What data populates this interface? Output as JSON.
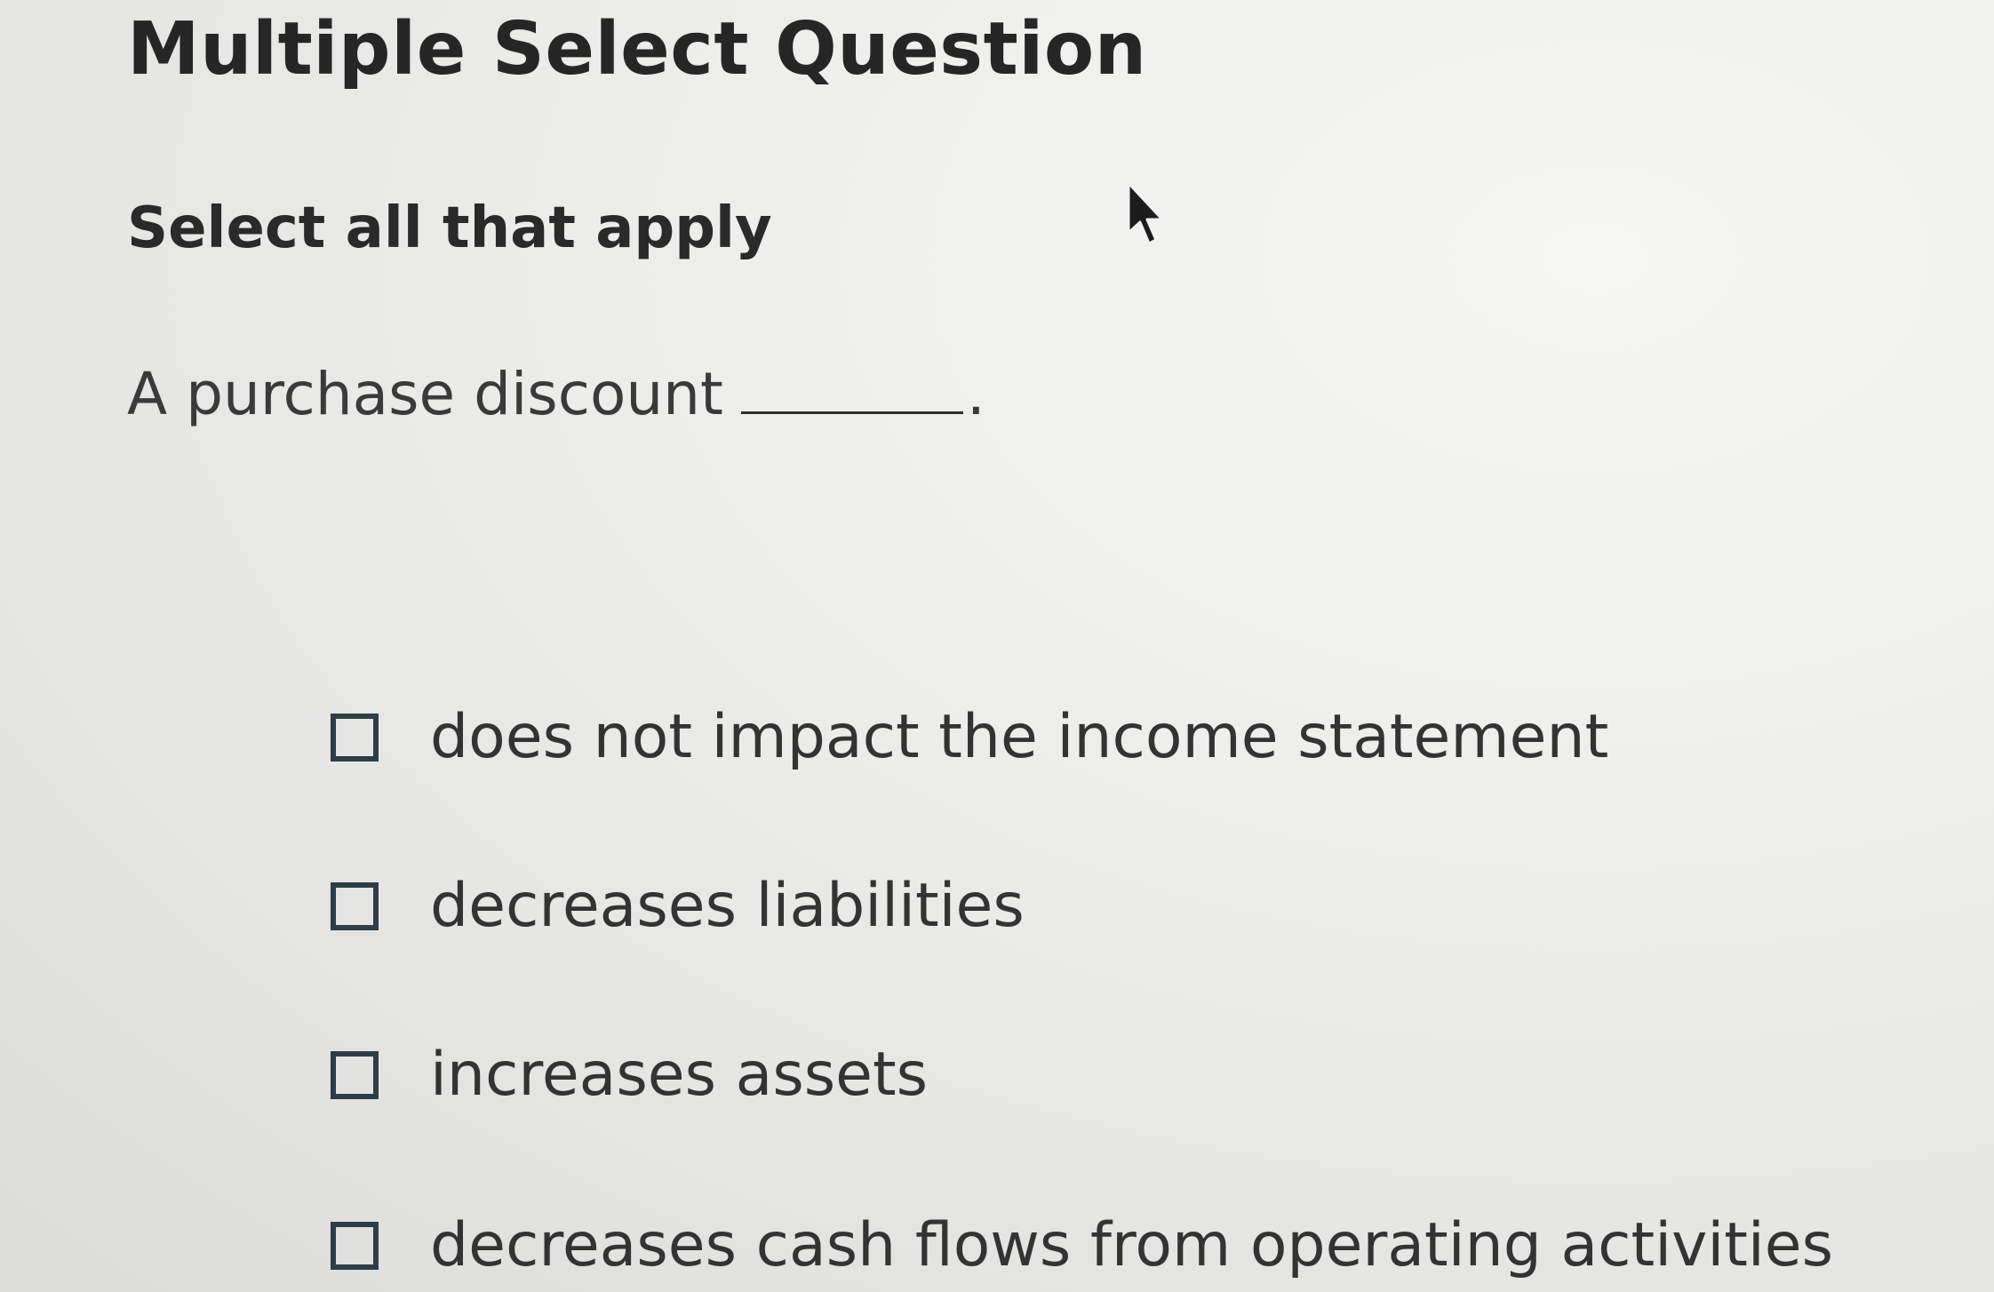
{
  "header": {
    "title": "Multiple Select Question"
  },
  "instruction": "Select all that apply",
  "question": {
    "text": "A purchase discount",
    "suffix": "."
  },
  "options": [
    {
      "label": "does not impact the income statement",
      "checked": false
    },
    {
      "label": "decreases liabilities",
      "checked": false
    },
    {
      "label": "increases assets",
      "checked": false
    },
    {
      "label": "decreases cash flows from operating activities",
      "checked": false
    }
  ],
  "icons": {
    "cursor": "mouse-pointer-icon",
    "checkbox": "checkbox-unchecked-icon"
  }
}
